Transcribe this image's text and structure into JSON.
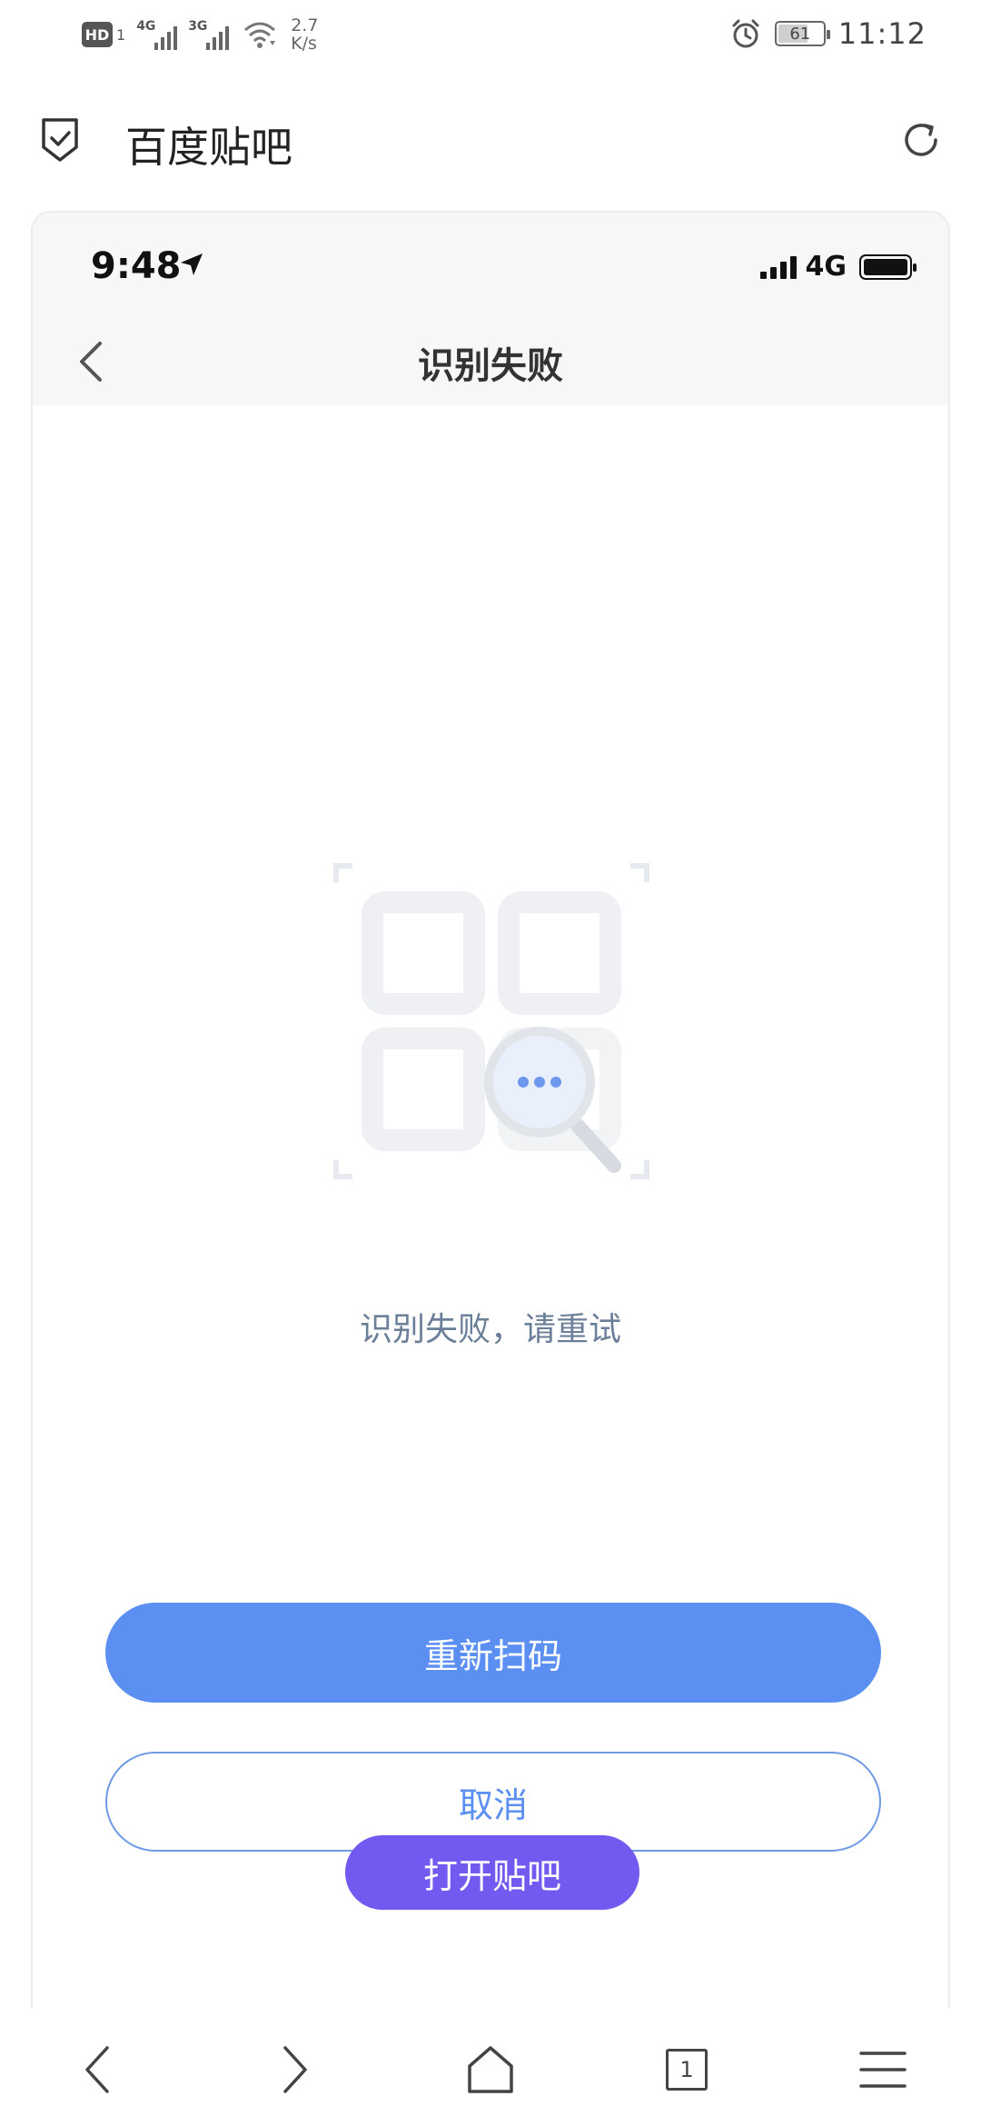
{
  "system_status": {
    "hd_badge": "HD",
    "sim_index": "1",
    "sim1_network": "4G",
    "sim2_network": "3G",
    "net_speed_value": "2.7",
    "net_speed_unit": "K/s",
    "battery_level": "61",
    "time": "11:12"
  },
  "browser": {
    "title": "百度贴吧",
    "icons": {
      "left": "shield-check-icon",
      "right": "refresh-icon"
    }
  },
  "embedded_screen": {
    "status": {
      "time": "9:48",
      "network": "4G"
    },
    "nav": {
      "title": "识别失败"
    },
    "message": "识别失败，请重试",
    "buttons": {
      "rescan": "重新扫码",
      "cancel": "取消"
    }
  },
  "overlay": {
    "open_app_button": "打开贴吧"
  },
  "toolbar": {
    "tab_count": "1",
    "icons": [
      "back-icon",
      "forward-icon",
      "home-icon",
      "tabs-icon",
      "menu-icon"
    ]
  },
  "colors": {
    "primary_blue": "#5b8ff2",
    "open_button_purple": "#7359f0",
    "message_text": "#6b7f99"
  }
}
